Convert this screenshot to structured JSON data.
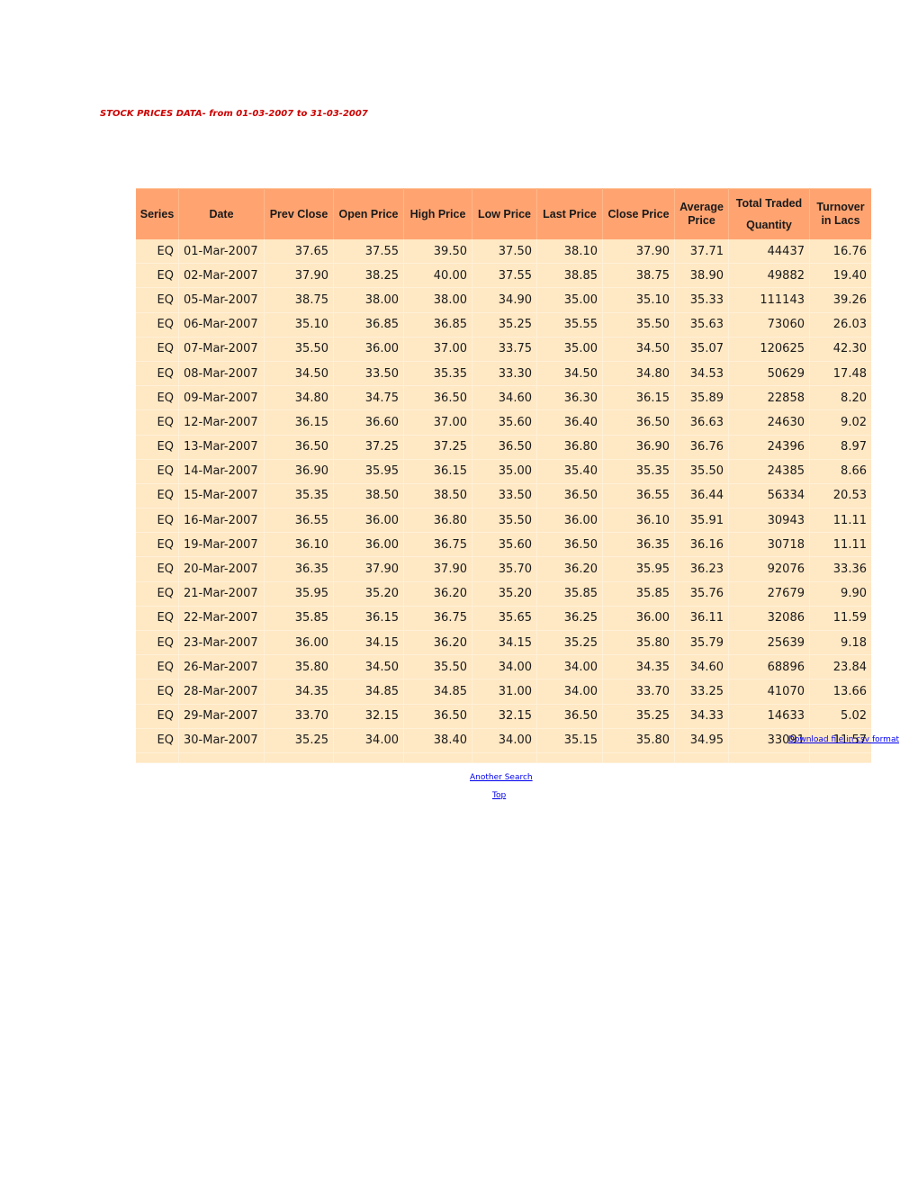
{
  "page": {
    "title": "STOCK PRICES DATA- from 01-03-2007 to 31-03-2007"
  },
  "table": {
    "headers": {
      "series": "Series",
      "date": "Date",
      "prev_close": "Prev Close",
      "open_price": "Open Price",
      "high_price": "High Price",
      "low_price": "Low Price",
      "last_price": "Last Price",
      "close_price": "Close Price",
      "average_price": "Average Price",
      "total_traded_quantity_line1": "Total Traded",
      "total_traded_quantity_line2": "Quantity",
      "turnover": "Turnover in Lacs"
    },
    "rows": [
      [
        "EQ",
        "01-Mar-2007",
        "37.65",
        "37.55",
        "39.50",
        "37.50",
        "38.10",
        "37.90",
        "37.71",
        "44437",
        "16.76"
      ],
      [
        "EQ",
        "02-Mar-2007",
        "37.90",
        "38.25",
        "40.00",
        "37.55",
        "38.85",
        "38.75",
        "38.90",
        "49882",
        "19.40"
      ],
      [
        "EQ",
        "05-Mar-2007",
        "38.75",
        "38.00",
        "38.00",
        "34.90",
        "35.00",
        "35.10",
        "35.33",
        "111143",
        "39.26"
      ],
      [
        "EQ",
        "06-Mar-2007",
        "35.10",
        "36.85",
        "36.85",
        "35.25",
        "35.55",
        "35.50",
        "35.63",
        "73060",
        "26.03"
      ],
      [
        "EQ",
        "07-Mar-2007",
        "35.50",
        "36.00",
        "37.00",
        "33.75",
        "35.00",
        "34.50",
        "35.07",
        "120625",
        "42.30"
      ],
      [
        "EQ",
        "08-Mar-2007",
        "34.50",
        "33.50",
        "35.35",
        "33.30",
        "34.50",
        "34.80",
        "34.53",
        "50629",
        "17.48"
      ],
      [
        "EQ",
        "09-Mar-2007",
        "34.80",
        "34.75",
        "36.50",
        "34.60",
        "36.30",
        "36.15",
        "35.89",
        "22858",
        "8.20"
      ],
      [
        "EQ",
        "12-Mar-2007",
        "36.15",
        "36.60",
        "37.00",
        "35.60",
        "36.40",
        "36.50",
        "36.63",
        "24630",
        "9.02"
      ],
      [
        "EQ",
        "13-Mar-2007",
        "36.50",
        "37.25",
        "37.25",
        "36.50",
        "36.80",
        "36.90",
        "36.76",
        "24396",
        "8.97"
      ],
      [
        "EQ",
        "14-Mar-2007",
        "36.90",
        "35.95",
        "36.15",
        "35.00",
        "35.40",
        "35.35",
        "35.50",
        "24385",
        "8.66"
      ],
      [
        "EQ",
        "15-Mar-2007",
        "35.35",
        "38.50",
        "38.50",
        "33.50",
        "36.50",
        "36.55",
        "36.44",
        "56334",
        "20.53"
      ],
      [
        "EQ",
        "16-Mar-2007",
        "36.55",
        "36.00",
        "36.80",
        "35.50",
        "36.00",
        "36.10",
        "35.91",
        "30943",
        "11.11"
      ],
      [
        "EQ",
        "19-Mar-2007",
        "36.10",
        "36.00",
        "36.75",
        "35.60",
        "36.50",
        "36.35",
        "36.16",
        "30718",
        "11.11"
      ],
      [
        "EQ",
        "20-Mar-2007",
        "36.35",
        "37.90",
        "37.90",
        "35.70",
        "36.20",
        "35.95",
        "36.23",
        "92076",
        "33.36"
      ],
      [
        "EQ",
        "21-Mar-2007",
        "35.95",
        "35.20",
        "36.20",
        "35.20",
        "35.85",
        "35.85",
        "35.76",
        "27679",
        "9.90"
      ],
      [
        "EQ",
        "22-Mar-2007",
        "35.85",
        "36.15",
        "36.75",
        "35.65",
        "36.25",
        "36.00",
        "36.11",
        "32086",
        "11.59"
      ],
      [
        "EQ",
        "23-Mar-2007",
        "36.00",
        "34.15",
        "36.20",
        "34.15",
        "35.25",
        "35.80",
        "35.79",
        "25639",
        "9.18"
      ],
      [
        "EQ",
        "26-Mar-2007",
        "35.80",
        "34.50",
        "35.50",
        "34.00",
        "34.00",
        "34.35",
        "34.60",
        "68896",
        "23.84"
      ],
      [
        "EQ",
        "28-Mar-2007",
        "34.35",
        "34.85",
        "34.85",
        "31.00",
        "34.00",
        "33.70",
        "33.25",
        "41070",
        "13.66"
      ],
      [
        "EQ",
        "29-Mar-2007",
        "33.70",
        "32.15",
        "36.50",
        "32.15",
        "36.50",
        "35.25",
        "34.33",
        "14633",
        "5.02"
      ],
      [
        "EQ",
        "30-Mar-2007",
        "35.25",
        "34.00",
        "38.40",
        "34.00",
        "35.15",
        "35.80",
        "34.95",
        "33091",
        "11.57"
      ]
    ]
  },
  "links": {
    "download_csv": "Download file in csv format",
    "another_search": "Another Search",
    "top": "Top"
  },
  "colors": {
    "title": "#cc0000",
    "header_bg": "#ffa471",
    "row_bg": "#ffe8c4",
    "link": "#0000ee"
  }
}
